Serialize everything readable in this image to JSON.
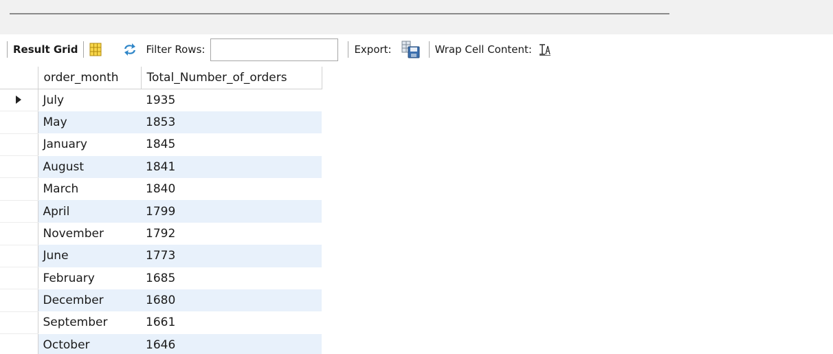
{
  "toolbar": {
    "result_grid_label": "Result Grid",
    "filter_rows_label": "Filter Rows:",
    "filter_rows_value": "",
    "export_label": "Export:",
    "wrap_cell_label": "Wrap Cell Content:",
    "icons": [
      "grid-layout-icon",
      "refresh-arrows-icon",
      "export-save-icon",
      "wrap-text-icon"
    ]
  },
  "grid": {
    "columns": [
      "order_month",
      "Total_Number_of_orders"
    ],
    "rows": [
      [
        "July",
        "1935"
      ],
      [
        "May",
        "1853"
      ],
      [
        "January",
        "1845"
      ],
      [
        "August",
        "1841"
      ],
      [
        "March",
        "1840"
      ],
      [
        "April",
        "1799"
      ],
      [
        "November",
        "1792"
      ],
      [
        "June",
        "1773"
      ],
      [
        "February",
        "1685"
      ],
      [
        "December",
        "1680"
      ],
      [
        "September",
        "1661"
      ],
      [
        "October",
        "1646"
      ]
    ],
    "selected_row": 0,
    "alt_row_color": "#e8f1fb"
  }
}
